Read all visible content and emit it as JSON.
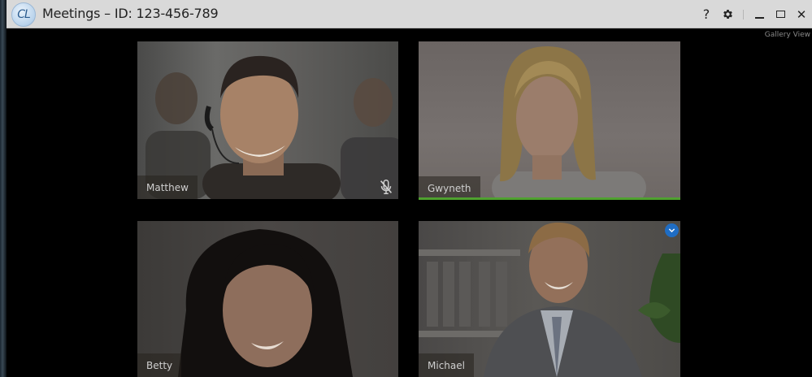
{
  "window": {
    "app_logo_text": "CL",
    "title": "Meetings – ID: 123-456-789",
    "help_glyph": "?",
    "settings_icon": "gear-icon",
    "minimize_icon": "minimize-icon",
    "maximize_icon": "maximize-icon",
    "close_glyph": "✕"
  },
  "view_mode": "Gallery View",
  "participants": [
    {
      "name": "Matthew",
      "muted": true,
      "speaking": false,
      "pinned": false
    },
    {
      "name": "Gwyneth",
      "muted": false,
      "speaking": true,
      "pinned": false
    },
    {
      "name": "Betty",
      "muted": false,
      "speaking": false,
      "pinned": false
    },
    {
      "name": "Michael",
      "muted": false,
      "speaking": false,
      "pinned": true
    }
  ],
  "colors": {
    "speaking_indicator": "#4fa12f",
    "pinned_badge": "#1f6dc4",
    "titlebar": "#d9d9d9",
    "stage_background": "#000000"
  }
}
